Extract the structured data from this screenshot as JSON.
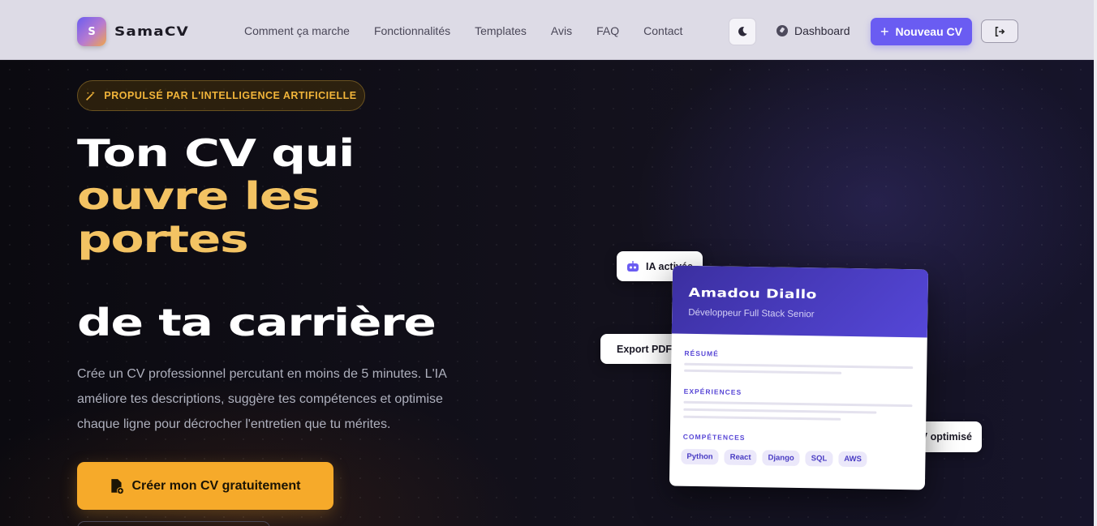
{
  "nav": {
    "logo_letter": "S",
    "brand": "SamaCV",
    "links": [
      "Comment ça marche",
      "Fonctionnalités",
      "Templates",
      "Avis",
      "FAQ",
      "Contact"
    ],
    "theme_icon": "moon-icon",
    "dashboard_label": "Dashboard",
    "new_cv_label": "Nouveau CV",
    "logout_icon": "logout-icon"
  },
  "hero": {
    "badge": "PROPULSÉ PAR L'INTELLIGENCE ARTIFICIELLE",
    "title_line1": "Ton CV qui",
    "title_line2": "ouvre les",
    "title_line3": "portes",
    "title_line4": "de ta carrière",
    "description": "Crée un CV professionnel percutant en moins de 5 minutes. L'IA améliore tes descriptions, suggère tes compétences et optimise chaque ligne pour décrocher l'entretien que tu mérites.",
    "cta_label": "Créer mon CV gratuitement"
  },
  "preview": {
    "badge_ai": "IA activée",
    "badge_export": "Export PDF",
    "badge_optimized": "CV optimisé",
    "name": "Amadou Diallo",
    "role": "Développeur Full Stack Senior",
    "section_summary": "RÉSUMÉ",
    "section_experience": "EXPÉRIENCES",
    "section_skills": "COMPÉTENCES",
    "skills": [
      "Python",
      "React",
      "Django",
      "SQL",
      "AWS"
    ]
  },
  "colors": {
    "accent": "#6a5cf2",
    "cta": "#f6aa2a",
    "highlight": "#f3c363",
    "background": "#0e0d14"
  }
}
